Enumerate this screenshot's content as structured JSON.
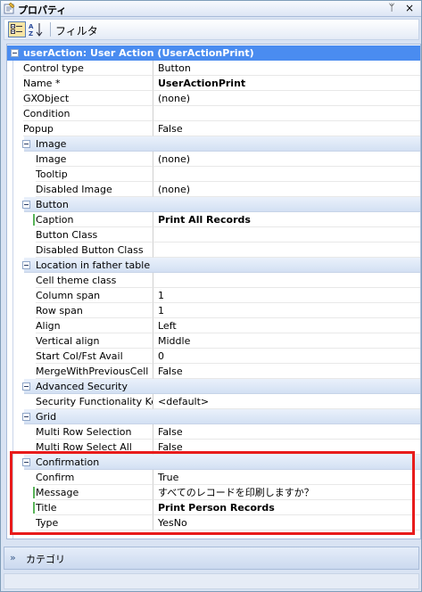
{
  "window": {
    "title": "プロパティ",
    "pin_glyph": "ᛘ",
    "close_glyph": "×"
  },
  "toolbar": {
    "filter_label": "フィルタ"
  },
  "object_header": "userAction: User Action (UserActionPrint)",
  "top_properties": [
    {
      "name": "Control type",
      "value": "Button",
      "bold": false
    },
    {
      "name": "Name *",
      "value": "UserActionPrint",
      "bold": true
    },
    {
      "name": "GXObject",
      "value": "(none)",
      "bold": false
    },
    {
      "name": "Condition",
      "value": "",
      "bold": false
    },
    {
      "name": "Popup",
      "value": "False",
      "bold": false
    }
  ],
  "categories": [
    {
      "name": "Image",
      "properties": [
        {
          "name": "Image",
          "value": "(none)",
          "bold": false
        },
        {
          "name": "Tooltip",
          "value": "",
          "bold": false
        },
        {
          "name": "Disabled Image",
          "value": "(none)",
          "bold": false
        }
      ]
    },
    {
      "name": "Button",
      "properties": [
        {
          "name": "Caption",
          "value": "Print All Records",
          "bold": true,
          "modified": true
        },
        {
          "name": "Button Class",
          "value": "",
          "bold": false
        },
        {
          "name": "Disabled Button Class",
          "value": "",
          "bold": false
        }
      ]
    },
    {
      "name": "Location in father table",
      "properties": [
        {
          "name": "Cell theme class",
          "value": "",
          "bold": false
        },
        {
          "name": "Column span",
          "value": "1",
          "bold": false
        },
        {
          "name": "Row span",
          "value": "1",
          "bold": false
        },
        {
          "name": "Align",
          "value": "Left",
          "bold": false
        },
        {
          "name": "Vertical align",
          "value": "Middle",
          "bold": false
        },
        {
          "name": "Start Col/Fst Avail",
          "value": "0",
          "bold": false
        },
        {
          "name": "MergeWithPreviousCell",
          "value": "False",
          "bold": false
        }
      ]
    },
    {
      "name": "Advanced Security",
      "properties": [
        {
          "name": "Security Functionality Key",
          "value": "<default>",
          "bold": false
        }
      ]
    },
    {
      "name": "Grid",
      "properties": [
        {
          "name": "Multi Row Selection",
          "value": "False",
          "bold": false
        },
        {
          "name": "Multi Row Select All",
          "value": "False",
          "bold": false
        }
      ]
    },
    {
      "name": "Confirmation",
      "properties": [
        {
          "name": "Confirm",
          "value": "True",
          "bold": false
        },
        {
          "name": "Message",
          "value": "すべてのレコードを印刷しますか？",
          "bold": false,
          "modified": true
        },
        {
          "name": "Title",
          "value": "Print Person Records",
          "bold": true,
          "modified": true
        },
        {
          "name": "Type",
          "value": "YesNo",
          "bold": false
        }
      ]
    }
  ],
  "bottom_bar": {
    "label": "カテゴリ",
    "chevron_glyph": "»"
  },
  "colors": {
    "header": "#4a8cf0",
    "highlight": "#e81b1b",
    "modified_mark": "#5ab55a"
  }
}
